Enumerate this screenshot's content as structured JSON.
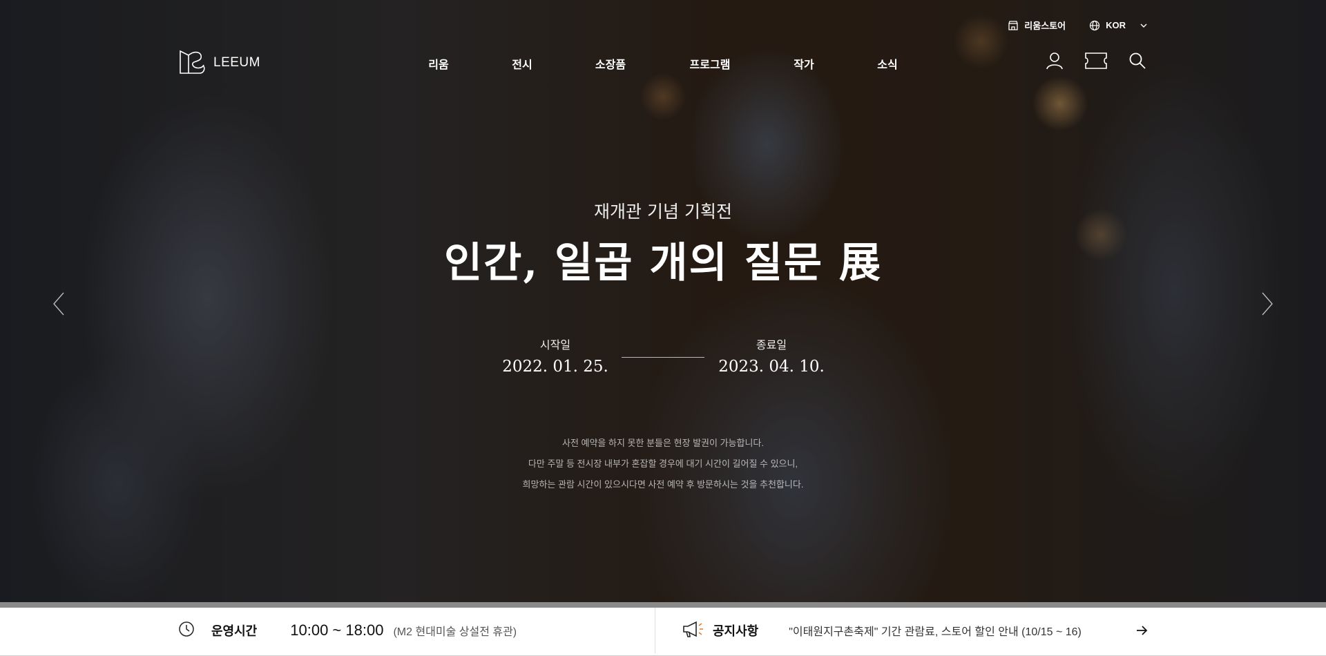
{
  "header": {
    "logo_text": "LEEUM",
    "store_label": "리움스토어",
    "lang_label": "KOR",
    "nav": [
      "리움",
      "전시",
      "소장품",
      "프로그램",
      "작가",
      "소식"
    ]
  },
  "hero": {
    "subtitle": "재개관 기념 기획전",
    "title": "인간, 일곱 개의 질문 展",
    "start_label": "시작일",
    "start_date": "2022. 01. 25.",
    "end_label": "종료일",
    "end_date": "2023. 04. 10.",
    "notice_lines": [
      "사전 예약을 하지 못한 분들은 현장 발권이 가능합니다.",
      "다만 주말 등 전시장 내부가 혼잡할 경우에 대기 시간이 길어질 수 있으니,",
      "희망하는 관람 시간이 있으시다면 사전 예약 후 방문하시는 것을 추천합니다."
    ]
  },
  "info_bar": {
    "hours_title": "운영시간",
    "hours": "10:00 ~ 18:00",
    "hours_note": "(M2 현대미술 상설전 휴관)",
    "notice_title": "공지사항",
    "notice_text": "\"이태원지구촌축제\" 기간 관람료, 스토어 할인 안내 (10/15 ~ 16)"
  },
  "icons": [
    "store-icon",
    "globe-icon",
    "chevron-down-icon",
    "user-icon",
    "ticket-icon",
    "search-icon",
    "arrow-left-icon",
    "arrow-right-icon",
    "clock-icon",
    "megaphone-icon",
    "arrow-right-icon"
  ],
  "colors": {
    "accent_orange": "#e07b2a",
    "info_bar_bg": "#ffffff"
  }
}
